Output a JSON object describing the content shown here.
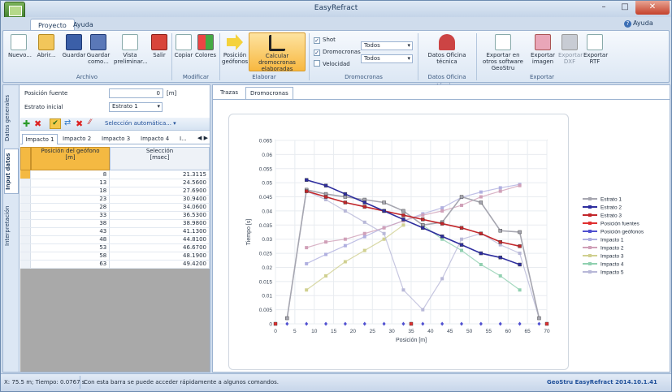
{
  "window": {
    "title": "EasyRefract",
    "min": "–",
    "max": "□",
    "close": "✕"
  },
  "menu_tabs": [
    "Proyecto",
    "Ayuda"
  ],
  "help_label": "Ayuda",
  "ribbon": {
    "archivo": {
      "label": "Archivo",
      "buttons": [
        "Nuevo...",
        "Abrir...",
        "Guardar",
        "Guardar como...",
        "Vista preliminar...",
        "Salir"
      ]
    },
    "modificar": {
      "label": "Modificar",
      "buttons": [
        "Copiar",
        "Colores"
      ]
    },
    "elaborar": {
      "label": "Elaborar",
      "buttons": [
        "Posición geófonos",
        "Calcular dromocronas elaboradas"
      ]
    },
    "dromocronas": {
      "label": "Dromocronas",
      "shot": "Shot",
      "dromocronas": "Dromocronas",
      "velocidad": "Velocidad",
      "combo1": "Todos",
      "combo2": "Todos"
    },
    "oficina": {
      "label": "Datos Oficina técnica",
      "buttons": [
        "Datos Oficina técnica"
      ]
    },
    "exportar": {
      "label": "Exportar",
      "buttons": [
        "Exportar en otros software GeoStru",
        "Exportar imagen",
        "Exportar DXF",
        "Exportar RTF"
      ]
    }
  },
  "left": {
    "vtabs": [
      "Datos generales",
      "Input datos",
      "Interpretación"
    ],
    "posicion_label": "Posición fuente",
    "posicion_value": "0",
    "posicion_unit": "[m]",
    "estrato_label": "Estrato inicial",
    "estrato_value": "Estrato 1",
    "seleccion": "Selección automática...",
    "impactos": [
      "Impacto 1",
      "Impacto 2",
      "Impacto 3",
      "Impacto 4",
      "I..."
    ],
    "col1": "Posición del geófono\n[m]",
    "col2": "Selección\n[msec]",
    "rows": [
      [
        "8",
        "21.3115"
      ],
      [
        "13",
        "24.5600"
      ],
      [
        "18",
        "27.6900"
      ],
      [
        "23",
        "30.9400"
      ],
      [
        "28",
        "34.0600"
      ],
      [
        "33",
        "36.5300"
      ],
      [
        "38",
        "38.9800"
      ],
      [
        "43",
        "41.1300"
      ],
      [
        "48",
        "44.8100"
      ],
      [
        "53",
        "46.6700"
      ],
      [
        "58",
        "48.1900"
      ],
      [
        "63",
        "49.4200"
      ]
    ]
  },
  "right_tabs": [
    "Trazas",
    "Dromocronas"
  ],
  "chart_data": {
    "type": "line",
    "xlabel": "Posición [m]",
    "ylabel": "Tiempo [s]",
    "xlim": [
      0,
      70
    ],
    "ylim": [
      0,
      0.065
    ],
    "xticks": [
      0,
      5,
      10,
      15,
      20,
      25,
      30,
      35,
      40,
      45,
      50,
      55,
      60,
      65,
      70
    ],
    "yticks": [
      0,
      0.005,
      0.01,
      0.015,
      0.02,
      0.025,
      0.03,
      0.035,
      0.04,
      0.045,
      0.05,
      0.055,
      0.06,
      0.065
    ],
    "series": [
      {
        "name": "Estrato 1",
        "color": "#a6a6b0",
        "x": [
          3,
          8,
          13,
          18,
          23,
          28,
          33,
          38,
          43,
          48,
          53,
          58,
          63,
          68
        ],
        "y": [
          0.002,
          0.0475,
          0.046,
          0.045,
          0.044,
          0.043,
          0.04,
          0.035,
          0.036,
          0.045,
          0.043,
          0.033,
          0.0325,
          0.002
        ]
      },
      {
        "name": "Estrato 2",
        "color": "#2d2d9e",
        "x": [
          8,
          13,
          18,
          23,
          28,
          33,
          38,
          43,
          48,
          53,
          58,
          63
        ],
        "y": [
          0.051,
          0.049,
          0.046,
          0.043,
          0.04,
          0.037,
          0.034,
          0.031,
          0.028,
          0.025,
          0.0235,
          0.021
        ]
      },
      {
        "name": "Estrato 3",
        "color": "#c2262a",
        "x": [
          8,
          13,
          18,
          23,
          28,
          33,
          38,
          43,
          48,
          53,
          58,
          63
        ],
        "y": [
          0.047,
          0.045,
          0.043,
          0.0415,
          0.04,
          0.0385,
          0.037,
          0.0355,
          0.034,
          0.032,
          0.029,
          0.0275
        ]
      },
      {
        "name": "Posición fuentes",
        "color": "#e03030",
        "x": [
          0,
          35,
          70
        ],
        "y": [
          0,
          0,
          0
        ]
      },
      {
        "name": "Posición geófonos",
        "color": "#5050d0",
        "x": [
          3,
          8,
          13,
          18,
          23,
          28,
          33,
          38,
          43,
          48,
          53,
          58,
          63,
          68
        ],
        "y": [
          0,
          0,
          0,
          0,
          0,
          0,
          0,
          0,
          0,
          0,
          0,
          0,
          0,
          0
        ]
      },
      {
        "name": "Impacto 1",
        "color": "#b0b0e0",
        "x": [
          8,
          13,
          18,
          23,
          28,
          33,
          38,
          43,
          48,
          53,
          58,
          63
        ],
        "y": [
          0.0213,
          0.0246,
          0.0277,
          0.0309,
          0.0341,
          0.0365,
          0.039,
          0.0411,
          0.0448,
          0.0467,
          0.0482,
          0.0494
        ]
      },
      {
        "name": "Impacto 2",
        "color": "#d0a0b8",
        "x": [
          8,
          13,
          18,
          23,
          28,
          33,
          38,
          43,
          48,
          53,
          58,
          63
        ],
        "y": [
          0.027,
          0.029,
          0.03,
          0.032,
          0.034,
          0.0365,
          0.0385,
          0.04,
          0.042,
          0.045,
          0.047,
          0.049
        ]
      },
      {
        "name": "Impacto 3",
        "color": "#d0d090",
        "x": [
          8,
          13,
          18,
          23,
          28,
          33
        ],
        "y": [
          0.012,
          0.017,
          0.022,
          0.026,
          0.03,
          0.035
        ]
      },
      {
        "name": "Impacto 4",
        "color": "#90d0b0",
        "x": [
          38,
          43,
          48,
          53,
          58,
          63
        ],
        "y": [
          0.035,
          0.03,
          0.026,
          0.021,
          0.017,
          0.012
        ]
      },
      {
        "name": "Impacto 5",
        "color": "#b8b8d8",
        "x": [
          3,
          8,
          13,
          18,
          23,
          28,
          33,
          38,
          43,
          48,
          53,
          58,
          63,
          68
        ],
        "y": [
          0.002,
          0.047,
          0.044,
          0.04,
          0.036,
          0.032,
          0.012,
          0.005,
          0.016,
          0.03,
          0.032,
          0.028,
          0.025,
          0.002
        ]
      }
    ]
  },
  "status": {
    "coords": "X: 75.5 m; Tiempo: 0.0767 s",
    "hint": "Con esta barra se puede acceder rápidamente a algunos comandos.",
    "brand": "GeoStru EasyRefract 2014.10.1.41"
  }
}
